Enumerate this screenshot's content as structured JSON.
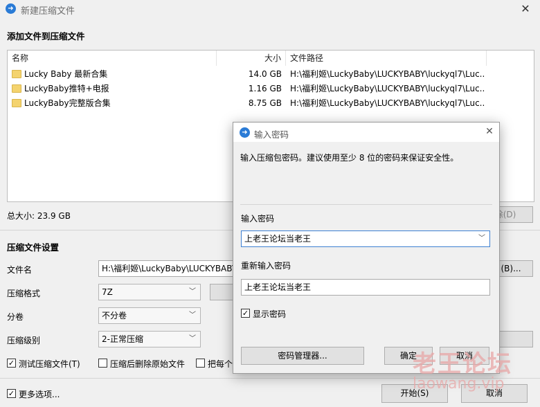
{
  "window": {
    "title": "新建压缩文件"
  },
  "add_section": {
    "title": "添加文件到压缩文件"
  },
  "file_table": {
    "headers": {
      "name": "名称",
      "size": "大小",
      "path": "文件路径"
    },
    "rows": [
      {
        "name": "Lucky Baby 最新合集",
        "size": "14.0 GB",
        "path": "H:\\福利姬\\LuckyBaby\\LUCKYBABY\\luckyql7\\Luc..."
      },
      {
        "name": "LuckyBaby推特+电报",
        "size": "1.16 GB",
        "path": "H:\\福利姬\\LuckyBaby\\LUCKYBABY\\luckyql7\\Luc..."
      },
      {
        "name": "LuckyBaby完整版合集",
        "size": "8.75 GB",
        "path": "H:\\福利姬\\LuckyBaby\\LUCKYBABY\\luckyql7\\Luc..."
      }
    ]
  },
  "total_size": "总大小: 23.9 GB",
  "remove_button": "除(D)",
  "settings": {
    "title": "压缩文件设置",
    "filename_label": "文件名",
    "filename_value": "H:\\福利姬\\LuckyBaby\\LUCKYBABY",
    "browse_button": "(B)...",
    "format_label": "压缩格式",
    "format_value": "7Z",
    "split_label": "分卷",
    "split_value": "不分卷",
    "level_label": "压缩级别",
    "level_value": "2-正常压缩",
    "test_checkbox": "测试压缩文件(T)",
    "delete_checkbox": "压缩后删除原始文件",
    "each_checkbox": "把每个"
  },
  "footer": {
    "more_options": "更多选项...",
    "start_button": "开始(S)",
    "cancel_button": "取消"
  },
  "password_dialog": {
    "title": "输入密码",
    "description": "输入压缩包密码。建议使用至少 8 位的密码来保证安全性。",
    "password_label": "输入密码",
    "password_value": "上老王论坛当老王",
    "confirm_label": "重新输入密码",
    "confirm_value": "上老王论坛当老王",
    "show_password": "显示密码",
    "manager_button": "密码管理器...",
    "ok_button": "确定",
    "cancel_button": "取消"
  },
  "watermark": {
    "text": "老王论坛",
    "url": "laowang.vip"
  }
}
